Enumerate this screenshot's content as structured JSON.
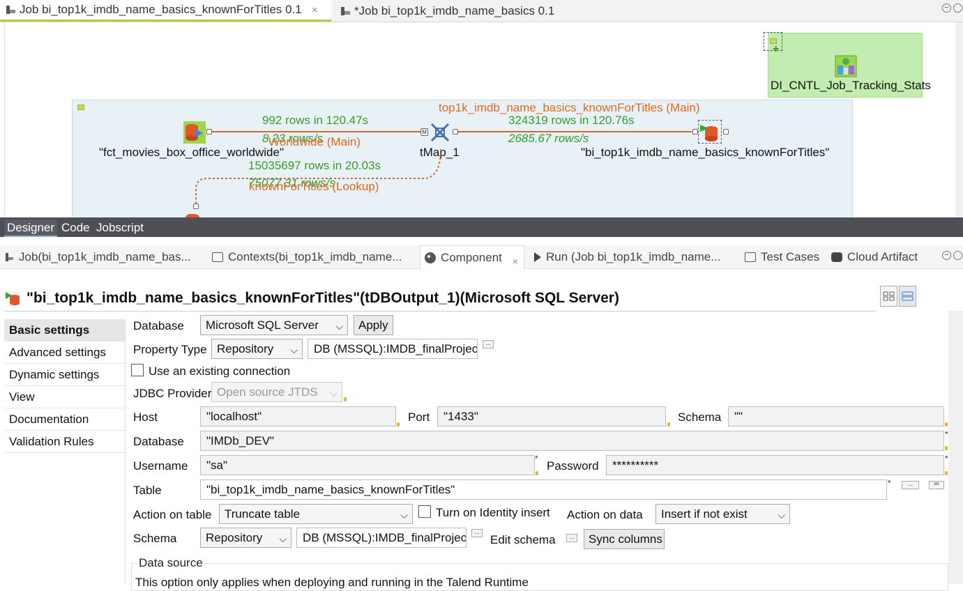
{
  "editor_tabs": [
    {
      "label": "Job bi_top1k_imdb_name_basics_knownForTitles 0.1",
      "close": "×"
    },
    {
      "label": "*Job bi_top1k_imdb_name_basics 0.1"
    }
  ],
  "canvas": {
    "tracking_component_label": "DI_CNTL_Job_Tracking_Stats",
    "source_label": "\"fct_movies_box_office_worldwide\"",
    "tmap_label": "tMap_1",
    "target_label": "\"bi_top1k_imdb_name_basics_knownForTitles\"",
    "flow1_rows": "992 rows in 120.47s",
    "flow1_rate": "8.23 rows/s",
    "flow1_name": "Worldwide (Main)",
    "flow2_name": "top1k_imdb_name_basics_knownForTitles (Main)",
    "flow2_rows": "324319 rows in 120.76s",
    "flow2_rate": "2685.67 rows/s",
    "lookup_rows": "15035697 rows in 20.03s",
    "lookup_rate": "75077.31 rows/s",
    "lookup_name": "knownForTitles (Lookup)",
    "main_badge": "M"
  },
  "designer_tabs": [
    "Designer",
    "Code",
    "Jobscript"
  ],
  "view_tabs": [
    {
      "label": "Job(bi_top1k_imdb_name_bas...",
      "icon": "job-icon"
    },
    {
      "label": "Contexts(bi_top1k_imdb_name...",
      "icon": "contexts-icon"
    },
    {
      "label": "Component",
      "icon": "palette-icon",
      "close": "×"
    },
    {
      "label": "Run (Job bi_top1k_imdb_name...",
      "icon": "run-icon"
    },
    {
      "label": "Test Cases",
      "icon": "test-cases-icon"
    },
    {
      "label": "Cloud Artifact",
      "icon": "cloud-artifact-icon"
    }
  ],
  "component_title": "\"bi_top1k_imdb_name_basics_knownForTitles\"(tDBOutput_1)(Microsoft SQL Server)",
  "side_nav": [
    "Basic settings",
    "Advanced settings",
    "Dynamic settings",
    "View",
    "Documentation",
    "Validation Rules"
  ],
  "form": {
    "database_label": "Database",
    "database_value": "Microsoft SQL Server",
    "apply": "Apply",
    "property_type_label": "Property Type",
    "property_type_value": "Repository",
    "property_repo_value": "DB (MSSQL):IMDB_finalProjec",
    "use_existing_connection": "Use an existing connection",
    "jdbc_label": "JDBC Provider",
    "jdbc_value": "Open source JTDS",
    "host_label": "Host",
    "host_value": "\"localhost\"",
    "port_label": "Port",
    "port_value": "\"1433\"",
    "schema_label": "Schema",
    "schema_value": "\"\"",
    "db_label": "Database",
    "db_value": "\"IMDb_DEV\"",
    "username_label": "Username",
    "username_value": "\"sa\"",
    "password_label": "Password",
    "password_value": "**********",
    "table_label": "Table",
    "table_value": "\"bi_top1k_imdb_name_basics_knownForTitles\"",
    "action_table_label": "Action on table",
    "action_table_value": "Truncate table",
    "identity_insert": "Turn on Identity insert",
    "action_data_label": "Action on data",
    "action_data_value": "Insert if not exist",
    "schema2_label": "Schema",
    "schema2_value": "Repository",
    "schema2_repo_value": "DB (MSSQL):IMDB_finalProjec",
    "edit_schema": "Edit schema",
    "sync_columns": "Sync columns",
    "data_source_title": "Data source",
    "data_source_text": "This option only applies when deploying and running in the Talend Runtime",
    "ellipsis": "...",
    "required_mark": "*",
    "chevron": "⌵"
  }
}
